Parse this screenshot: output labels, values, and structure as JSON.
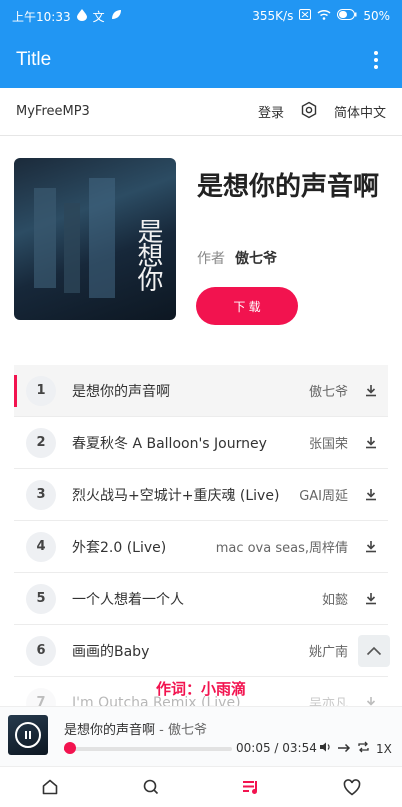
{
  "status_bar": {
    "time": "上午10:33",
    "left_glyph": "文",
    "speed": "355K/s",
    "battery": "50%"
  },
  "app_bar": {
    "title": "Title"
  },
  "top_nav": {
    "brand": "MyFreeMP3",
    "login": "登录",
    "language": "简体中文"
  },
  "hero": {
    "title": "是想你的声音啊",
    "artist_label": "作者",
    "artist": "傲七爷",
    "download_label": "下 载",
    "cover_text": "是想你"
  },
  "songs": [
    {
      "index": "1",
      "name": "是想你的声音啊",
      "artist": "傲七爷"
    },
    {
      "index": "2",
      "name": "春夏秋冬 A Balloon's Journey",
      "artist": "张国荣"
    },
    {
      "index": "3",
      "name": "烈火战马+空城计+重庆魂 (Live)",
      "artist": "GAI周延"
    },
    {
      "index": "4",
      "name": "外套2.0 (Live)",
      "artist": "mac ova seas,周梓倩"
    },
    {
      "index": "5",
      "name": "一个人想着一个人",
      "artist": "如懿"
    },
    {
      "index": "6",
      "name": "画画的Baby",
      "artist": "姚广南"
    },
    {
      "index": "7",
      "name": "I'm Outcha Remix (Live)",
      "artist": "吴亦凡"
    }
  ],
  "lyric": "作词：小雨滴",
  "player": {
    "title": "是想你的声音啊",
    "separator": " - ",
    "artist": "傲七爷",
    "current_time": "00:05",
    "total_time": "03:54",
    "time_separator": " / ",
    "speed": "1X",
    "progress": 0.021
  },
  "colors": {
    "primary": "#2196f3",
    "accent": "#f2134f"
  },
  "icons": {
    "settings": "gear-icon",
    "download": "download-icon",
    "up": "chevron-up-icon",
    "play": "pause-icon",
    "volume": "volume-icon",
    "next": "arrow-right-icon",
    "repeat": "repeat-icon",
    "tabs": [
      "home-icon",
      "search-icon",
      "playlist-icon",
      "heart-icon"
    ]
  }
}
